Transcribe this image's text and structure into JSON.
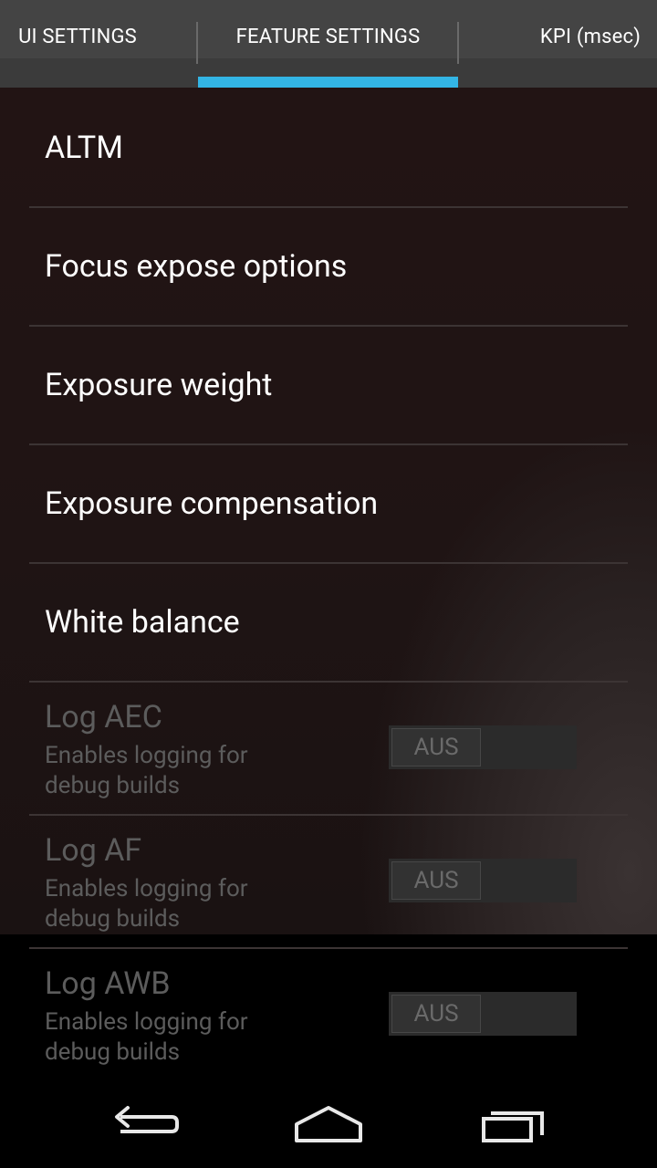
{
  "tabs": [
    {
      "label": "UI SETTINGS"
    },
    {
      "label": "FEATURE SETTINGS"
    },
    {
      "label": "KPI (msec)"
    }
  ],
  "active_tab": "FEATURE SETTINGS",
  "menu_items": [
    {
      "label": "ALTM"
    },
    {
      "label": "Focus expose options"
    },
    {
      "label": "Exposure weight"
    },
    {
      "label": "Exposure compensation"
    },
    {
      "label": "White balance"
    }
  ],
  "toggles": [
    {
      "title": "Log AEC",
      "subtitle_line1": "Enables logging for",
      "subtitle_line2": "debug builds",
      "state": "AUS"
    },
    {
      "title": "Log AF",
      "subtitle_line1": "Enables logging for",
      "subtitle_line2": "debug builds",
      "state": "AUS"
    },
    {
      "title": "Log AWB",
      "subtitle_line1": "Enables logging for",
      "subtitle_line2": "debug builds",
      "state": "AUS"
    }
  ],
  "navbar": {
    "back": "back-icon",
    "home": "home-icon",
    "recents": "recents-icon"
  },
  "colors": {
    "accent": "#33b5e5",
    "tab_background": "#444444",
    "disabled_text": "#5c5c5c"
  }
}
